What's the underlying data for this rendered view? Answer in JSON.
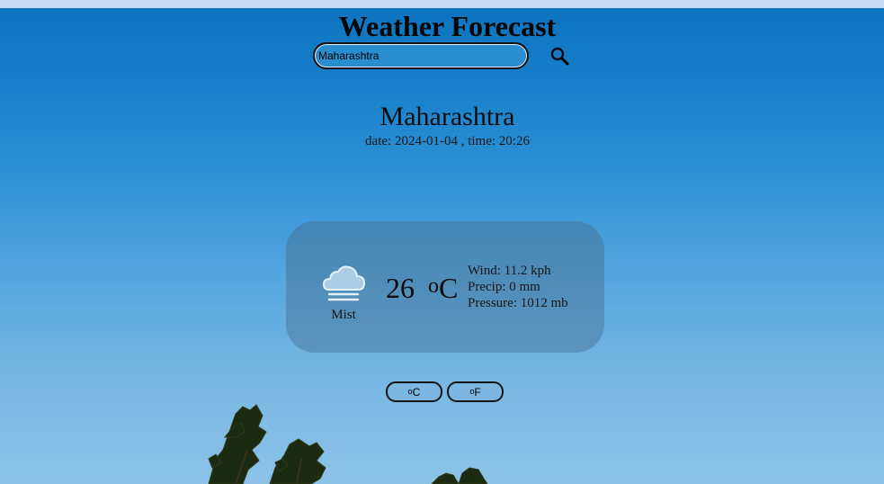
{
  "header": {
    "title": "Weather Forecast"
  },
  "search": {
    "value": "Maharashtra",
    "icon": "search-icon"
  },
  "location": {
    "city": "Maharashtra",
    "date_label": "date:",
    "date": "2024-01-04",
    "time_label": ", time:",
    "time": "20:26"
  },
  "current": {
    "condition": "Mist",
    "condition_icon": "cloud-mist-icon",
    "temp": "26",
    "temp_unit_deg": "o",
    "temp_unit_letter": "C",
    "wind": "Wind: 11.2 kph",
    "precip": "Precip: 0 mm",
    "pressure": "Pressure: 1012 mb"
  },
  "units": {
    "celsius": {
      "deg": "o",
      "letter": "C"
    },
    "fahrenheit": {
      "deg": "o",
      "letter": "F"
    }
  },
  "colors": {
    "card_bg": "#466e8c",
    "sky_top": "#0b72bd",
    "sky_bottom": "#8cc2e6"
  }
}
